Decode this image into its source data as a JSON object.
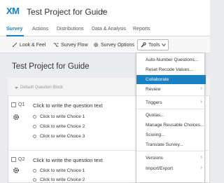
{
  "header": {
    "logo": "XM",
    "project_title": "Test Project for Guide"
  },
  "tabs": [
    {
      "label": "Survey",
      "active": true
    },
    {
      "label": "Actions"
    },
    {
      "label": "Distributions"
    },
    {
      "label": "Data & Analysis"
    },
    {
      "label": "Reports"
    }
  ],
  "toolbar": {
    "look_feel": "Look & Feel",
    "survey_flow": "Survey Flow",
    "survey_options": "Survey Options",
    "tools": "Tools"
  },
  "survey": {
    "title": "Test Project for Guide",
    "block_label": "Default Question Block",
    "questions": [
      {
        "id": "Q1",
        "text": "Click to write the question text",
        "choices": [
          "Click to write Choice 1",
          "Click to write Choice 2",
          "Click to write Choice 3"
        ]
      },
      {
        "id": "Q2",
        "text": "Click to write the question text",
        "choices": [
          "Click to write Choice 1",
          "Click to write Choice 2"
        ]
      }
    ]
  },
  "tools_menu": {
    "items": [
      {
        "label": "Auto-Number Questions..."
      },
      {
        "label": "Reset Recode Values..."
      },
      {
        "label": "Collaborate",
        "highlighted": true
      },
      {
        "label": "Review",
        "submenu": true
      },
      {
        "label": "Triggers",
        "submenu": true
      },
      {
        "label": "Quotas..."
      },
      {
        "label": "Manage Reusable Choices..."
      },
      {
        "label": "Scoring..."
      },
      {
        "label": "Translate Survey..."
      },
      {
        "label": "Versions",
        "submenu": true
      },
      {
        "label": "Import/Export",
        "submenu": true
      }
    ],
    "submenu_arrow": "›"
  },
  "colors": {
    "accent": "#1a7fc1",
    "highlight": "#1a82c4"
  }
}
